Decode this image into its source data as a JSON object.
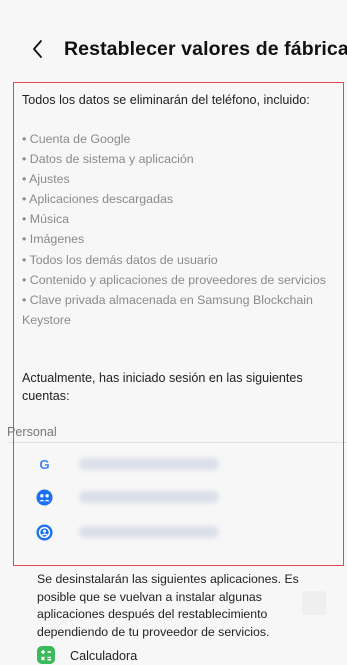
{
  "header": {
    "title": "Restablecer valores de fábrica"
  },
  "content": {
    "intro": "Todos los datos se eliminarán del teléfono, incluido:",
    "bullets": [
      "• Cuenta de Google",
      "• Datos de sistema y aplicación",
      "• Ajustes",
      "• Aplicaciones descargadas",
      "• Música",
      "• Imágenes",
      "• Todos los demás datos de usuario",
      "• Contenido y aplicaciones de proveedores de servicios",
      "• Clave privada almacenada en Samsung Blockchain Keystore"
    ],
    "signed_in": "Actualmente, has iniciado sesión en las siguientes cuentas:"
  },
  "accounts": {
    "section_title": "Personal",
    "items": [
      {
        "icon": "google-icon"
      },
      {
        "icon": "samsung-people-icon"
      },
      {
        "icon": "samsung-account-icon"
      }
    ]
  },
  "apps_notice": {
    "text": "Se desinstalarán las siguientes aplicaciones. Es posible que se vuelvan a instalar algunas aplicaciones después del restablecimiento dependiendo de tu proveedor de servicios.",
    "items": [
      {
        "label": "Calculadora",
        "icon": "calculator-icon"
      }
    ]
  },
  "colors": {
    "highlight": "#e54450",
    "google_blue": "#4285F4",
    "samsung_blue": "#1a6ff2",
    "calculator_green": "#3bba5c"
  }
}
